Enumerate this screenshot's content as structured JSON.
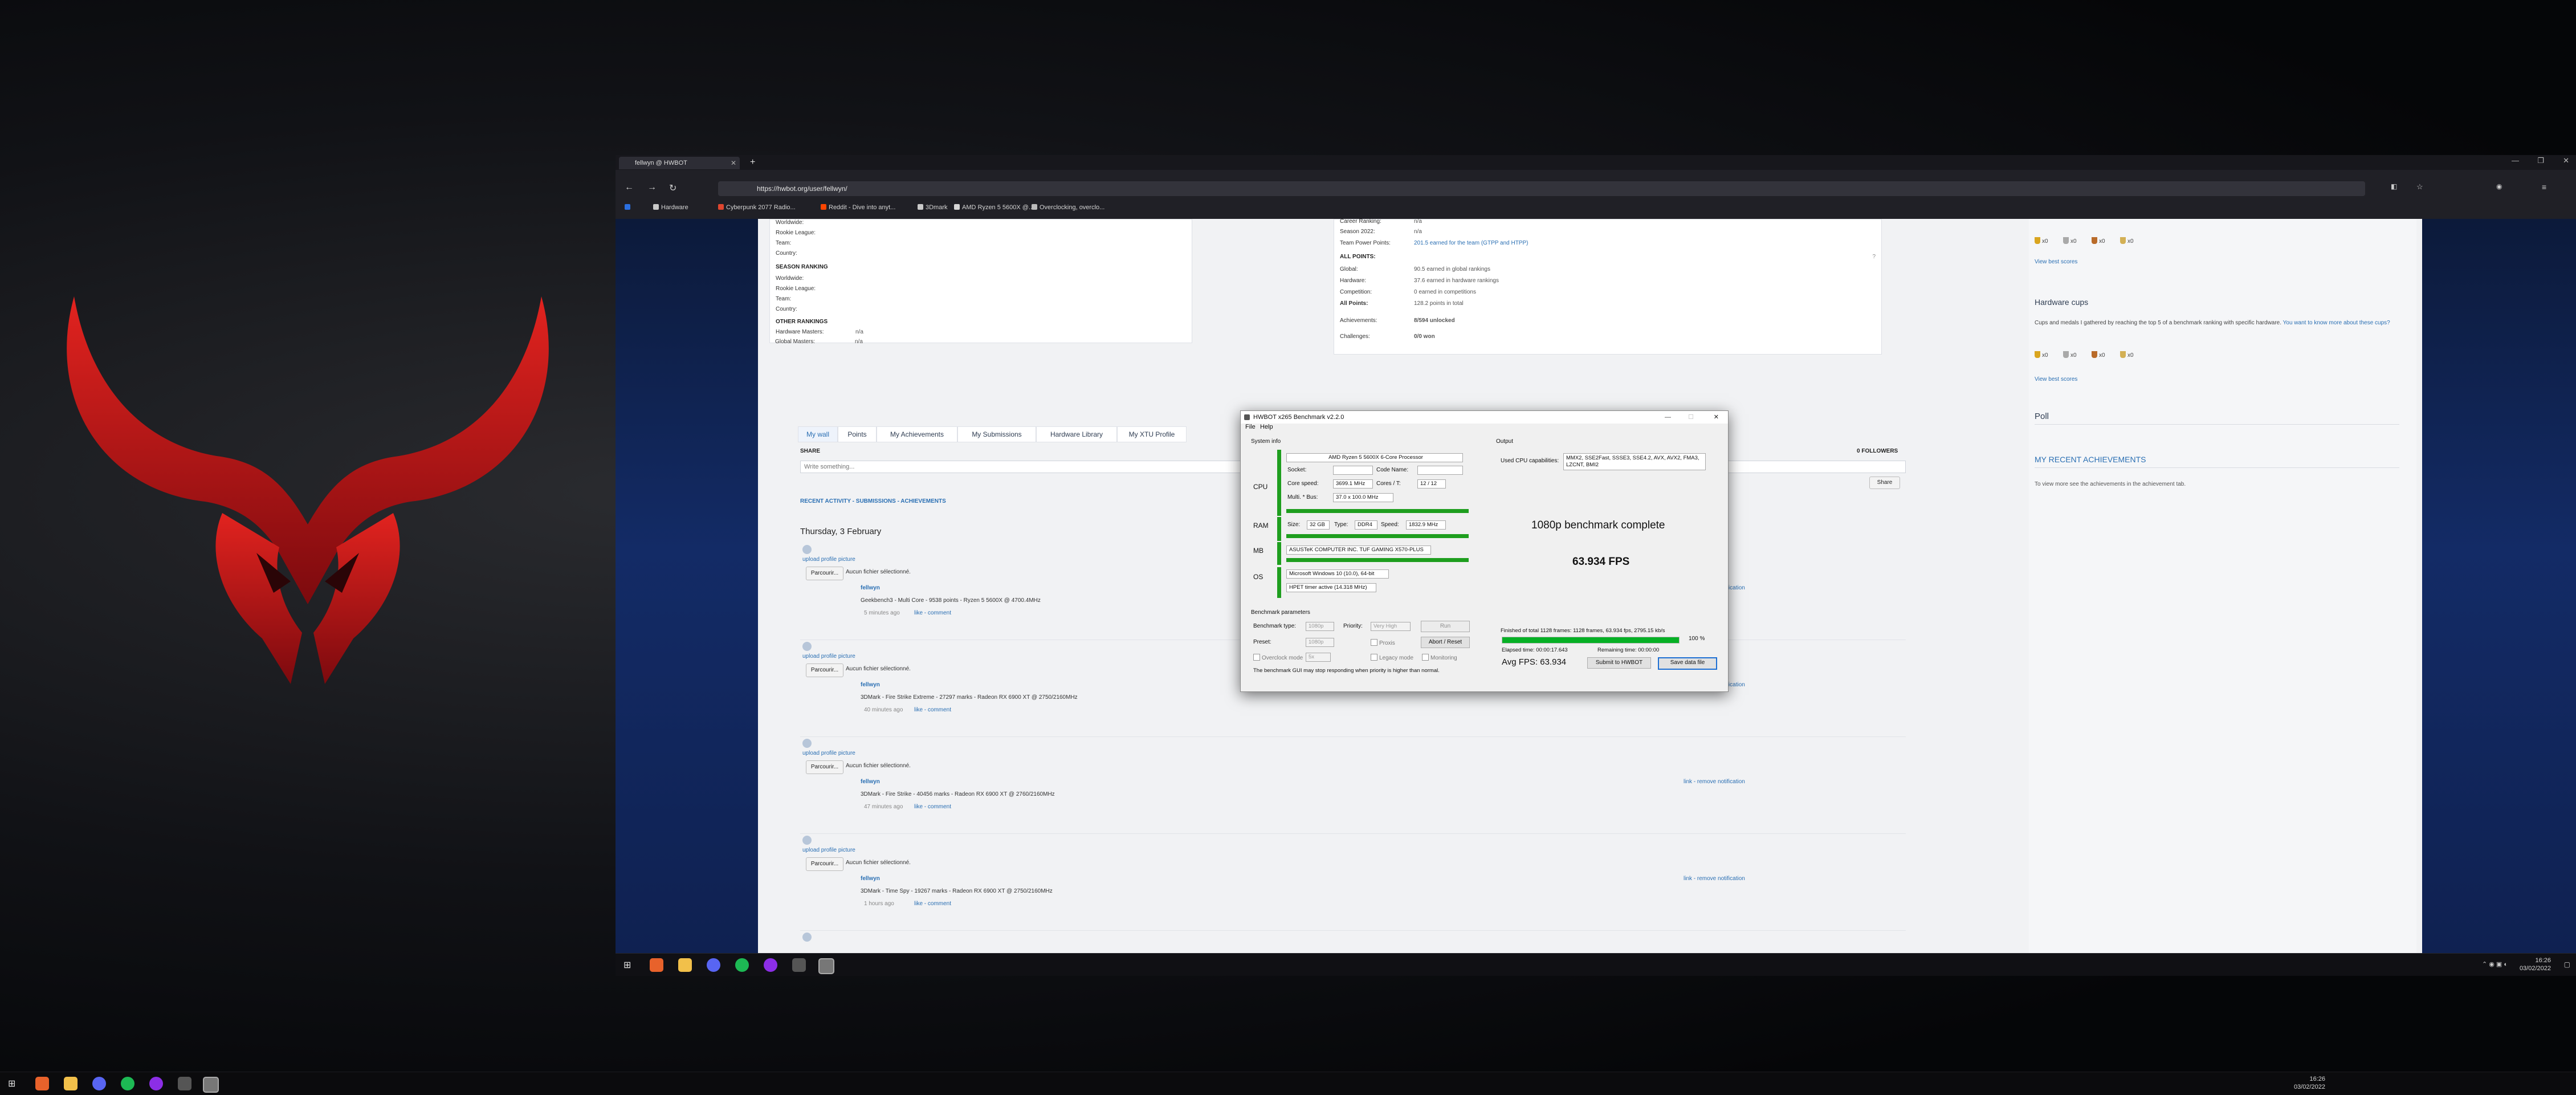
{
  "desktop": {
    "taskbar_clock": {
      "time": "16:26",
      "date": "03/02/2022"
    }
  },
  "browser": {
    "tab_title": "fellwyn @ HWBOT",
    "url": "https://hwbot.org/user/fellwyn/",
    "bookmarks": [
      "Hardware",
      "Cyberpunk 2077 Radio...",
      "Reddit - Dive into anyt...",
      "3Dmark",
      "AMD Ryzen 5 5600X @...",
      "Overclocking, overclo..."
    ],
    "taskbar_clock": {
      "time": "16:26",
      "date": "03/02/2022"
    }
  },
  "profile": {
    "left_top": [
      {
        "label": "Worldwide:",
        "value": ""
      },
      {
        "label": "Rookie League:",
        "value": ""
      },
      {
        "label": "Team:",
        "value": ""
      },
      {
        "label": "Country:",
        "value": ""
      }
    ],
    "season_ranking_heading": "SEASON RANKING",
    "season_ranking": [
      {
        "label": "Worldwide:",
        "value": ""
      },
      {
        "label": "Rookie League:",
        "value": ""
      },
      {
        "label": "Team:",
        "value": ""
      },
      {
        "label": "Country:",
        "value": ""
      }
    ],
    "other_rankings_heading": "OTHER RANKINGS",
    "other_rankings": [
      {
        "label": "Hardware Masters:",
        "value": "n/a"
      },
      {
        "label": "Global Masters:",
        "value": "n/a"
      }
    ],
    "right_top": [
      {
        "label": "Career Ranking:",
        "value": "n/a"
      },
      {
        "label": "Season 2022:",
        "value": "n/a"
      },
      {
        "label": "Team Power Points:",
        "value": "201.5 earned for the team (GTPP and HTPP)"
      }
    ],
    "all_points_heading": "ALL POINTS:",
    "all_points": [
      {
        "label": "Global:",
        "value": "90.5 earned in global rankings"
      },
      {
        "label": "Hardware:",
        "value": "37.6 earned in hardware rankings"
      },
      {
        "label": "Competition:",
        "value": "0 earned in competitions"
      },
      {
        "label": "All Points:",
        "value": "128.2 points in total"
      }
    ],
    "achievements": {
      "label": "Achievements:",
      "value": "8/594 unlocked"
    },
    "challenges": {
      "label": "Challenges:",
      "value": "0/0 won"
    }
  },
  "sidebar": {
    "top_link": "View best scores",
    "top_cups": [
      "x0",
      "x0",
      "x0",
      "x0"
    ],
    "hardware_cups_title": "Hardware cups",
    "hardware_cups_desc": "Cups and medals I gathered by reaching the top 5 of a benchmark ranking with specific hardware.",
    "hardware_cups_link": "You want to know more about these cups?",
    "hardware_cups": [
      "x0",
      "x0",
      "x0",
      "x0"
    ],
    "best_scores_link": "View best scores",
    "poll_title": "Poll",
    "achievements_title": "MY RECENT ACHIEVEMENTS",
    "achievements_text": "To view more see the achievements in the achievement tab."
  },
  "profile_tabs": [
    "My wall",
    "Points",
    "My Achievements",
    "My Submissions",
    "Hardware Library",
    "My XTU Profile"
  ],
  "wall": {
    "share_label": "SHARE",
    "followers": "0 FOLLOWERS",
    "share_placeholder": "Write something...",
    "share_button": "Share",
    "filter_text": "RECENT ACTIVITY - SUBMISSIONS - ACHIEVEMENTS",
    "date_heading": "Thursday, 3 February",
    "upload_link": "upload profile picture",
    "browse_button": "Parcourir...",
    "no_file": "Aucun fichier sélectionné.",
    "username": "fellwyn",
    "like_comment": "like - comment",
    "notif_link": "link - remove notification",
    "posts": [
      {
        "text": "Geekbench3 - Multi Core - 9538 points - Ryzen 5 5600X @ 4700.4MHz",
        "time": "5 minutes ago"
      },
      {
        "text": "3DMark - Fire Strike Extreme - 27297 marks - Radeon RX 6900 XT @ 2750/2160MHz",
        "time": "40 minutes ago"
      },
      {
        "text": "3DMark - Fire Strike - 40456 marks - Radeon RX 6900 XT @ 2760/2160MHz",
        "time": "47 minutes ago"
      },
      {
        "text": "3DMark - Time Spy - 19267 marks - Radeon RX 6900 XT @ 2750/2160MHz",
        "time": "1 hours ago"
      }
    ]
  },
  "benchmark": {
    "title": "HWBOT x265 Benchmark v2.2.0",
    "menu": [
      "File",
      "Help"
    ],
    "system_info_label": "System info",
    "output_label": "Output",
    "cpu": {
      "section": "CPU",
      "name": "AMD Ryzen 5 5600X 6-Core Processor",
      "socket_label": "Socket:",
      "socket": "",
      "codename_label": "Code Name:",
      "codename": "",
      "core_speed_label": "Core speed:",
      "core_speed": "3699.1 MHz",
      "cores_label": "Cores / T:",
      "cores": "12 / 12",
      "multi_label": "Multi. * Bus:",
      "multi": "37.0 x 100.0 MHz"
    },
    "ram": {
      "section": "RAM",
      "size_label": "Size:",
      "size": "32 GB",
      "type_label": "Type:",
      "type": "DDR4",
      "speed_label": "Speed:",
      "speed": "1832.9 MHz"
    },
    "mb": {
      "section": "MB",
      "name": "ASUSTeK COMPUTER INC. TUF GAMING X570-PLUS"
    },
    "os": {
      "section": "OS",
      "name": "Microsoft Windows 10 (10.0), 64-bit",
      "timer": "HPET timer active (14.318 MHz)"
    },
    "cpu_caps_label": "Used CPU capabilities:",
    "cpu_caps": "MMX2, SSE2Fast, SSSE3, SSE4.2, AVX, AVX2, FMA3, LZCNT, BMI2",
    "status": "1080p benchmark complete",
    "fps_big": "63.934 FPS",
    "params_label": "Benchmark parameters",
    "bench_type_label": "Benchmark type:",
    "bench_type": "1080p",
    "priority_label": "Priority:",
    "priority": "Very High",
    "preset_label": "Preset:",
    "preset": "1080p",
    "overclock_label": "Overclock mode",
    "overclock_value": "5x",
    "legacy_label": "Legacy mode",
    "monitoring_label": "Monitoring",
    "proxis_label": "Proxis",
    "run_button": "Run",
    "abort_button": "Abort / Reset",
    "warning": "The benchmark GUI may stop responding when priority is higher than normal.",
    "finished": "Finished of total 1128 frames: 1128 frames, 63.934 fps, 2795.15 kb/s",
    "progress_pct": "100 %",
    "progress_value": 1.0,
    "elapsed": "Elapsed time: 00:00:17.643",
    "remaining": "Remaining time: 00:00:00",
    "avg_fps": "Avg FPS: 63.934",
    "submit_button": "Submit to HWBOT",
    "save_button": "Save data file"
  },
  "colors": {
    "accent": "#1e9e1e",
    "link": "#2a6fb3",
    "logo_red": "#c1161c"
  }
}
